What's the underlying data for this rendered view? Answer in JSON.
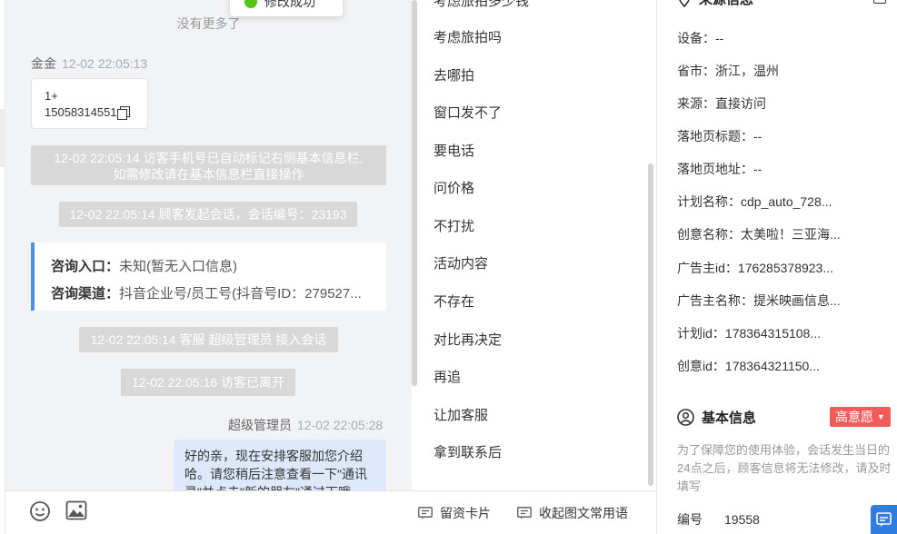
{
  "toast": {
    "text": "修改成功"
  },
  "chat": {
    "no_more": "没有更多了",
    "msg1": {
      "sender": "金金",
      "time": "12-02 22:05:13",
      "line1": "1+",
      "line2": "15058314551"
    },
    "sys1_line1": "12-02 22:05:14 访客手机号已自动标记右侧基本信息栏,",
    "sys1_line2": "如需修改请在基本信息栏直接操作",
    "sys2": "12-02 22:05:14 顾客发起会话，会话编号：23193",
    "info": {
      "entry_label": "咨询入口：",
      "entry_value": "未知(暂无入口信息)",
      "channel_label": "咨询渠道：",
      "channel_value": "抖音企业号/员工号(抖音号ID：279527..."
    },
    "sys3": "12-02 22:05:14 客服 超级管理员 接入会话",
    "sys4": "12-02 22:05:16 访客已离开",
    "msg2": {
      "sender": "超级管理员",
      "time": "12-02 22:05:28",
      "text": "好的亲，现在安排客服加您介绍哈。请您稍后注意查看一下\"通讯录\"并点击\"新的朋友\"通过下哦"
    }
  },
  "phrases": {
    "top_partial": "考虑旅拍多少钱",
    "items": [
      "考虑旅拍吗",
      "去哪拍",
      "窗口发不了",
      "要电话",
      "问价格",
      "不打扰",
      "活动内容",
      "不存在",
      "对比再决定",
      "再追",
      "让加客服",
      "拿到联系后"
    ]
  },
  "toolbar": {
    "emoji_icon": "smile-icon",
    "image_icon": "image-icon",
    "card_label": "留资卡片",
    "collapse_label": "收起图文常用语"
  },
  "source_info": {
    "title": "来源信息",
    "rows": [
      {
        "label": "设备：",
        "value": "--"
      },
      {
        "label": "省市：",
        "value": "浙江，温州"
      },
      {
        "label": "来源：",
        "value": "直接访问"
      },
      {
        "label": "落地页标题：",
        "value": "--"
      },
      {
        "label": "落地页地址：",
        "value": "--"
      },
      {
        "label": "计划名称：",
        "value": "cdp_auto_728..."
      },
      {
        "label": "创意名称：",
        "value": "太美啦！三亚海..."
      },
      {
        "label": "广告主id：",
        "value": "176285378923..."
      },
      {
        "label": "广告主名称：",
        "value": "提米映画信息..."
      },
      {
        "label": "计划id：",
        "value": "178364315108..."
      },
      {
        "label": "创意id：",
        "value": "178364321150..."
      }
    ]
  },
  "basic_info": {
    "title": "基本信息",
    "intent_badge": "高意愿",
    "hint": "为了保障您的使用体验，会话发生当日的24点之后，顾客信息将无法修改，请及时填写",
    "number_label": "编号",
    "number_value": "19558"
  }
}
